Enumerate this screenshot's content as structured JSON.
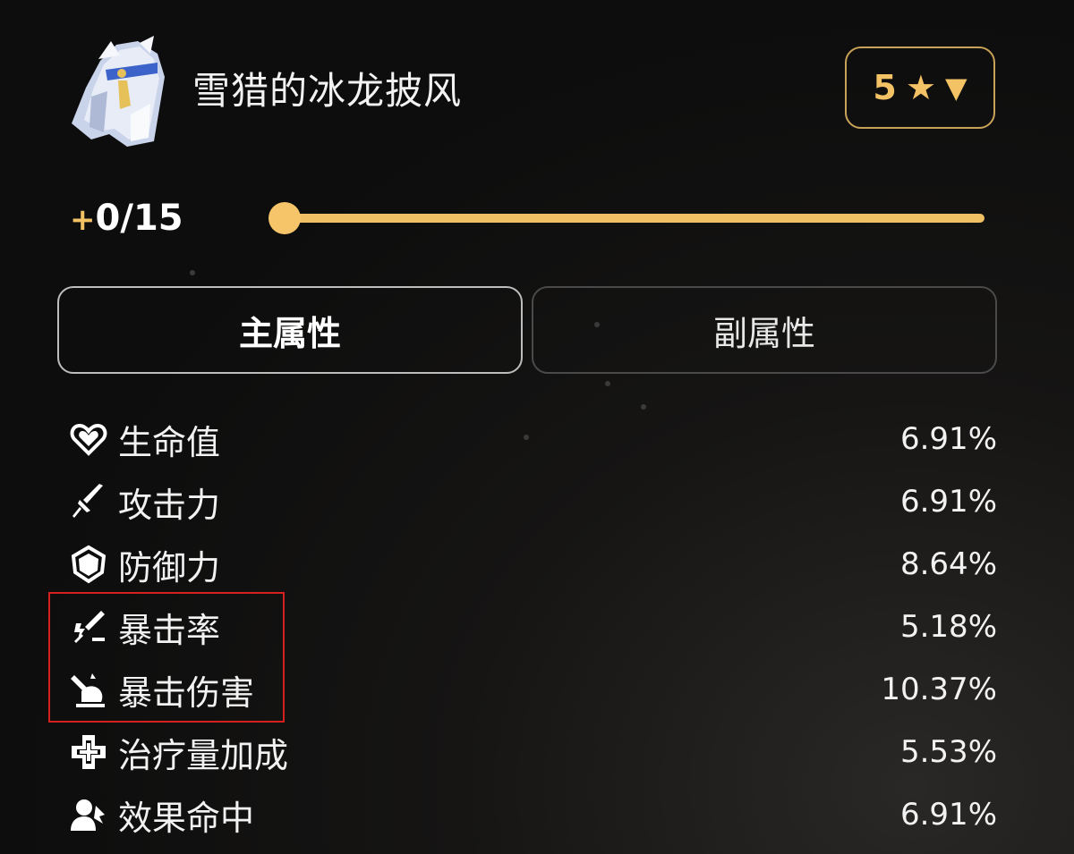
{
  "item": {
    "name": "雪猎的冰龙披风",
    "icon": "cloak-icon"
  },
  "rarity": {
    "value": "5",
    "star_icon": "★",
    "caret_icon": "▼"
  },
  "level": {
    "plus": "+",
    "text": "0/15",
    "current": 0,
    "max": 15
  },
  "tabs": {
    "main": "主属性",
    "sub": "副属性",
    "active": "main"
  },
  "stats": [
    {
      "icon": "heart-icon",
      "name": "生命值",
      "value": "6.91%"
    },
    {
      "icon": "sword-icon",
      "name": "攻击力",
      "value": "6.91%"
    },
    {
      "icon": "shield-icon",
      "name": "防御力",
      "value": "8.64%"
    },
    {
      "icon": "crit-rate-icon",
      "name": "暴击率",
      "value": "5.18%"
    },
    {
      "icon": "crit-damage-icon",
      "name": "暴击伤害",
      "value": "10.37%"
    },
    {
      "icon": "healing-cross-icon",
      "name": "治疗量加成",
      "value": "5.53%"
    },
    {
      "icon": "effect-hit-icon",
      "name": "效果命中",
      "value": "6.91%"
    }
  ],
  "colors": {
    "accent": "#f3c265",
    "highlight": "#d62020",
    "background": "#0d0d0d"
  }
}
